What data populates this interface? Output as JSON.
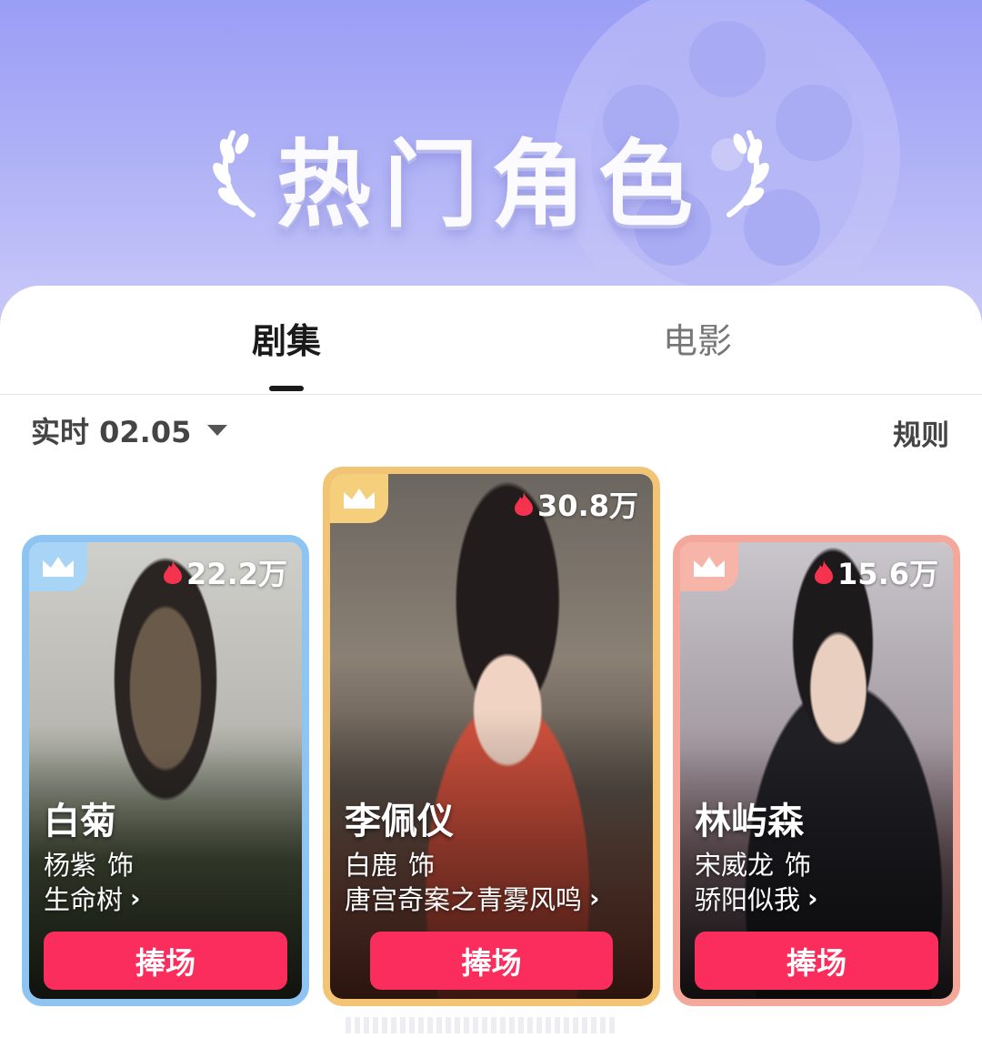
{
  "banner": {
    "title": "热门角色"
  },
  "tabs": [
    {
      "label": "剧集",
      "active": true
    },
    {
      "label": "电影",
      "active": false
    }
  ],
  "filter": {
    "label": "实时 02.05",
    "rules": "规则"
  },
  "cards": [
    {
      "rank_color": "#8ec4f2",
      "heat": "22.2万",
      "character": "白菊",
      "actor": "杨紫",
      "actor_suffix": "饰",
      "show": "生命树",
      "button": "捧场"
    },
    {
      "rank_color": "#f3c474",
      "heat": "30.8万",
      "character": "李佩仪",
      "actor": "白鹿",
      "actor_suffix": "饰",
      "show": "唐宫奇案之青雾风鸣",
      "button": "捧场"
    },
    {
      "rank_color": "#f4a79b",
      "heat": "15.6万",
      "character": "林屿森",
      "actor": "宋威龙",
      "actor_suffix": "饰",
      "show": "骄阳似我",
      "button": "捧场"
    }
  ],
  "icons": {
    "crown": "crown-icon",
    "flame": "flame-icon",
    "chevron": "chevron-right-icon",
    "caret": "caret-down-icon",
    "laurel": "laurel-icon",
    "film_reel": "film-reel-icon"
  },
  "colors": {
    "banner": "#aeb0f6",
    "accent_button": "#fb2d5c",
    "flame": "#f6334e"
  }
}
